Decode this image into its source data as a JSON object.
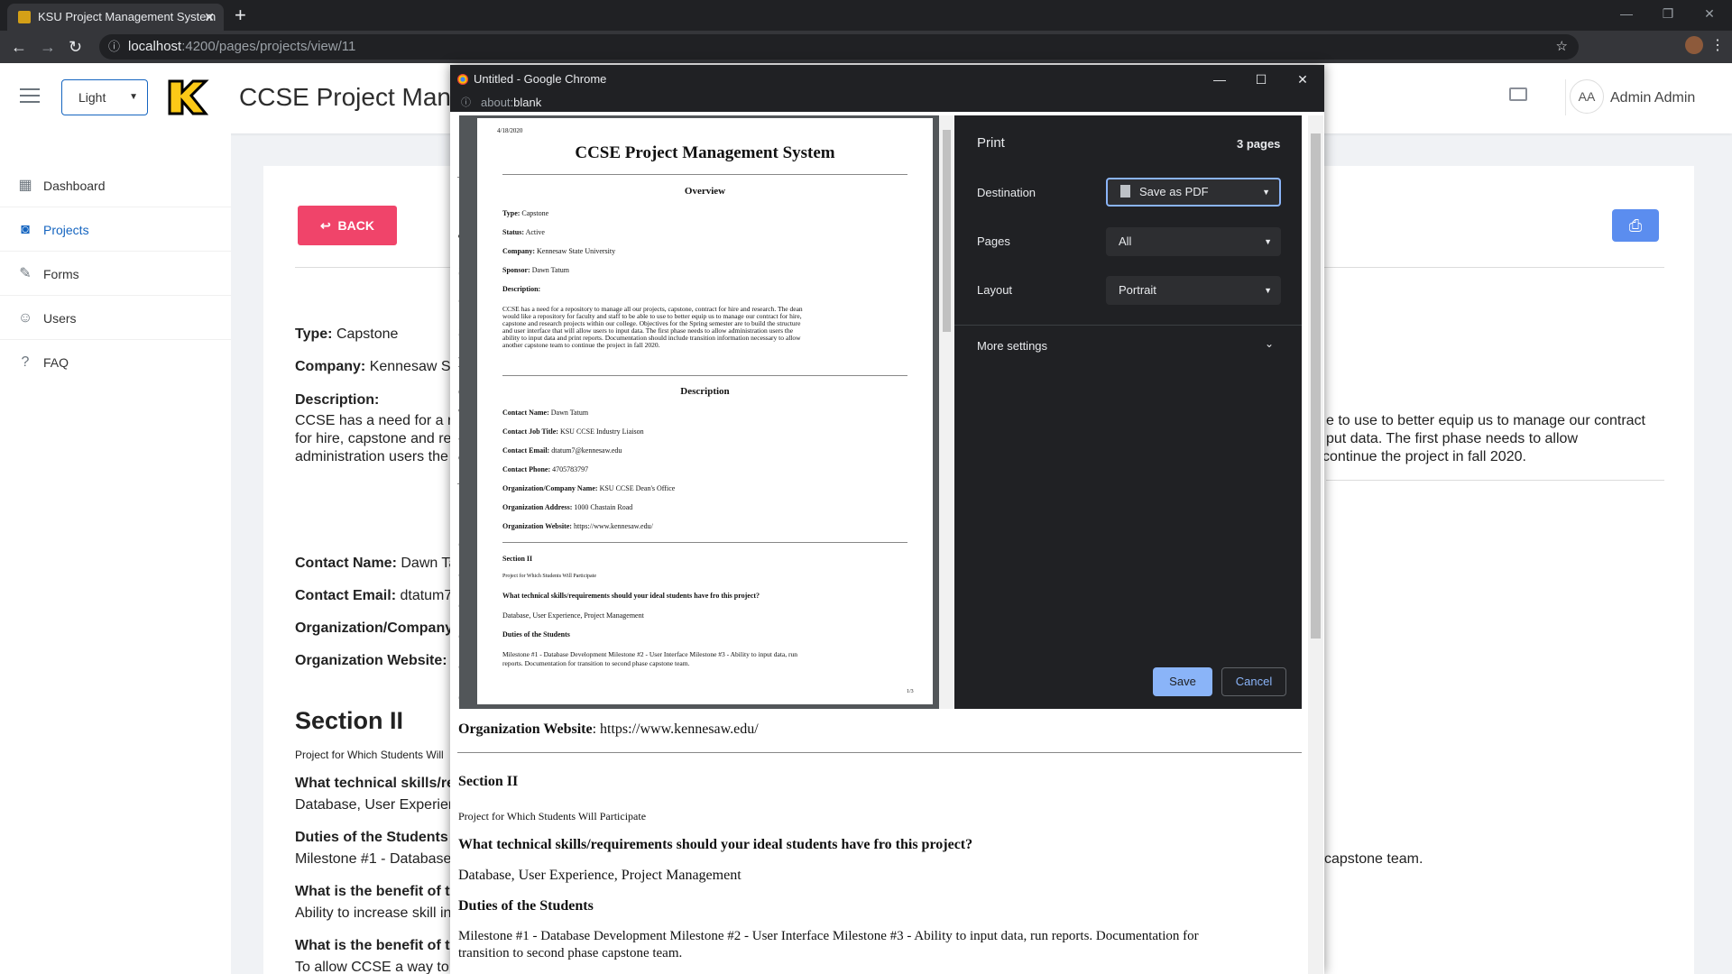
{
  "browser": {
    "tab_title": "KSU Project Management System",
    "url_host": "localhost",
    "url_path": ":4200/pages/projects/view/11"
  },
  "header": {
    "theme_value": "Light",
    "app_title": "CCSE Project Management System",
    "avatar_initials": "AA",
    "user_name": "Admin Admin"
  },
  "sidebar": {
    "items": [
      {
        "label": "Dashboard",
        "icon": "grid-icon"
      },
      {
        "label": "Projects",
        "icon": "inbox-icon"
      },
      {
        "label": "Forms",
        "icon": "pencil-icon"
      },
      {
        "label": "Users",
        "icon": "users-icon"
      },
      {
        "label": "FAQ",
        "icon": "question-icon"
      }
    ]
  },
  "main": {
    "back_label": "BACK",
    "type_label": "Type:",
    "type_value": "Capstone",
    "company_label": "Company:",
    "company_value": "Kennesaw Sta",
    "description_label": "Description:",
    "desc_line1": "CCSE has a need for a re",
    "desc_line2": "for hire, capstone and re",
    "desc_line3": "administration users the",
    "desc_right1": "e to use to better equip us to manage our contract",
    "desc_right2": "put data. The first phase needs to allow",
    "desc_right3": "continue the project in fall 2020.",
    "contact_name_label": "Contact Name:",
    "contact_name_value": "Dawn Ta",
    "contact_email_label": "Contact Email:",
    "contact_email_value": "dtatum7",
    "org_company_label": "Organization/Company",
    "org_website_label": "Organization Website:",
    "section2_title": "Section II",
    "section2_sub": "Project for Which Students Will",
    "q_skills": "What technical skills/re",
    "a_skills": "Database, User Experien",
    "duties_label": "Duties of the Students",
    "duties_value": "Milestone #1 - Database",
    "duties_right": "capstone team.",
    "benefit1_label": "What is the benefit of t",
    "benefit1_value": "Ability to increase skill in",
    "benefit2_label": "What is the benefit of t",
    "benefit2_value": "To allow CCSE a way to tr"
  },
  "popup": {
    "window_title": "Untitled - Google Chrome",
    "url_prefix": "about:",
    "url_value": "blank",
    "left_letters": [
      "Ty",
      "St",
      "Co",
      "Sp",
      "De"
    ],
    "left_desc": [
      "CC",
      "an",
      "Sp",
      "the",
      "co"
    ],
    "left_contact": [
      "Co",
      "Co",
      "Co",
      "Co",
      "Or",
      "Or"
    ],
    "org_website_label": "Organization Website",
    "org_website_value": ": https://www.kennesaw.edu/",
    "section2": "Section II",
    "section2_sub": "Project for Which Students Will Participate",
    "q_skills": "What technical skills/requirements should your ideal students have fro this project?",
    "a_skills": "Database, User Experience, Project Management",
    "duties_label": "Duties of the Students",
    "duties_line1": "Milestone #1 - Database Development Milestone #2 - User Interface Milestone #3 - Ability to input data, run reports. Documentation for",
    "duties_line2": "transition to second phase capstone team."
  },
  "preview": {
    "date": "4/18/2020",
    "title": "CCSE Project Management System",
    "overview": "Overview",
    "type_label": "Type:",
    "type_value": " Capstone",
    "status_label": "Status:",
    "status_value": " Active",
    "company_label": "Company:",
    "company_value": " Kennesaw State University",
    "sponsor_label": "Sponsor:",
    "sponsor_value": " Dawn Tatum",
    "description_label": "Description:",
    "desc": [
      "CCSE has a need for a repository to manage all our projects, capstone, contract for hire and research. The dean",
      "would like a repository for faculty and staff to be able to use to better equip us to manage our contract for hire,",
      "capstone and research projects within our college. Objectives for the Spring semester are to build the structure",
      "and user interface that will allow users to input data. The first phase needs to allow administration users the",
      "ability to input data and print reports. Documentation should include transition information necessary to allow",
      "another capstone team to continue the project in fall 2020."
    ],
    "description_heading": "Description",
    "contact_name_label": "Contact Name:",
    "contact_name_value": " Dawn Tatum",
    "contact_title_label": "Contact Job Title:",
    "contact_title_value": " KSU CCSE Industry Liaison",
    "contact_email_label": "Contact Email:",
    "contact_email_value": " dtatum7@kennesaw.edu",
    "contact_phone_label": "Contact Phone:",
    "contact_phone_value": " 4705783797",
    "org_name_label": "Organization/Company Name:",
    "org_name_value": " KSU CCSE Dean's Office",
    "org_address_label": "Organization Address:",
    "org_address_value": " 1000 Chastain Road",
    "org_website_label": "Organization Website:",
    "org_website_value": " https://www.kennesaw.edu/",
    "section2": "Section II",
    "section2_sub": "Project for Which Students Will Participate",
    "q_skills": "What technical skills/requirements should your ideal students have fro this project?",
    "a_skills": "Database, User Experience, Project Management",
    "duties_label": "Duties of the Students",
    "duties_line1": "Milestone #1 - Database Development Milestone #2 - User Interface Milestone #3 - Ability to input data, run",
    "duties_line2": "reports. Documentation for transition to second phase capstone team.",
    "page_num": "1/3"
  },
  "print_panel": {
    "title": "Print",
    "pages_count": "3 pages",
    "destination_label": "Destination",
    "destination_value": "Save as PDF",
    "pages_label": "Pages",
    "pages_value": "All",
    "layout_label": "Layout",
    "layout_value": "Portrait",
    "more_settings": "More settings",
    "save_label": "Save",
    "cancel_label": "Cancel"
  }
}
